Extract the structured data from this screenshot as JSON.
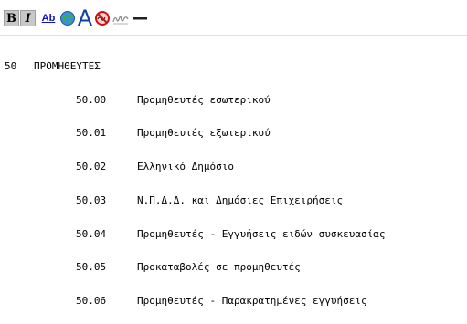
{
  "toolbar": {
    "bold_label": "B",
    "italic_label": "I",
    "ab_label": "Ab",
    "font_label": "A"
  },
  "account": {
    "code": "50",
    "title": "ΠΡΟΜΗΘΕΥΤΕΣ"
  },
  "rows": [
    {
      "code": "50.00",
      "label": "Προμηθευτές εσωτερικού"
    },
    {
      "code": "50.01",
      "label": "Προμηθευτές εξωτερικού"
    },
    {
      "code": "50.02",
      "label": "Ελληνικό Δημόσιο"
    },
    {
      "code": "50.03",
      "label": "Ν.Π.Δ.Δ. και Δημόσιες Επιχειρήσεις"
    },
    {
      "code": "50.04",
      "label": "Προμηθευτές - Εγγυήσεις ειδών συσκευασίας"
    },
    {
      "code": "50.05",
      "label": "Προκαταβολές σε προμηθευτές"
    },
    {
      "code": "50.06",
      "label": "Προμηθευτές - Παρακρατημένες εγγυήσεις"
    }
  ]
}
